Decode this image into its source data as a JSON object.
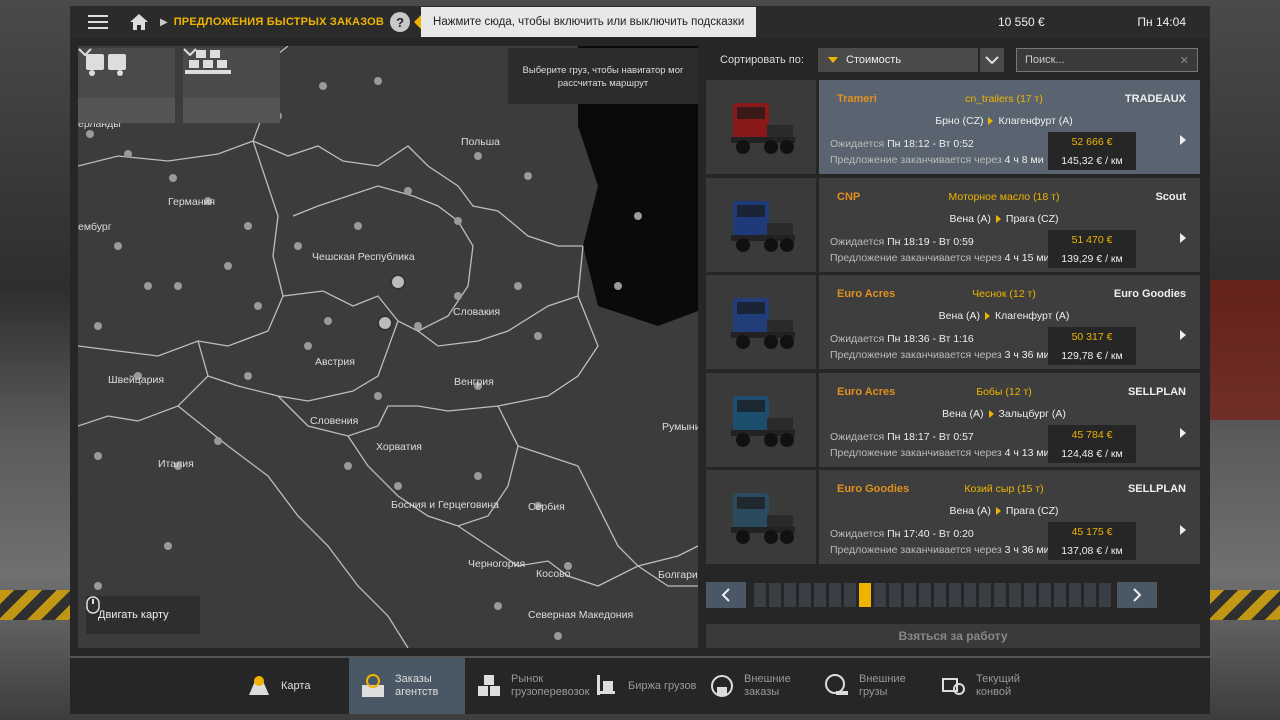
{
  "topbar": {
    "breadcrumb": "ПРЕДЛОЖЕНИЯ БЫСТРЫХ ЗАКАЗОВ",
    "help": "?",
    "tooltip": "Нажмите сюда, чтобы включить или выключить подсказки",
    "money": "10 550 €",
    "clock": "Пн 14:04"
  },
  "map": {
    "hint": "Выберите груз, чтобы навигатор мог рассчитать маршрут",
    "move_map": "Двигать карту",
    "labels": [
      {
        "text": "ерланды",
        "k": "l1"
      },
      {
        "text": "Польша",
        "k": "l2"
      },
      {
        "text": "Германия",
        "k": "l3"
      },
      {
        "text": "ембург",
        "k": "l4"
      },
      {
        "text": "Чешская Республика",
        "k": "l5"
      },
      {
        "text": "Словакия",
        "k": "l6"
      },
      {
        "text": "Австрия",
        "k": "l7"
      },
      {
        "text": "Швейцария",
        "k": "l8"
      },
      {
        "text": "Венгрия",
        "k": "l9"
      },
      {
        "text": "Словения",
        "k": "l10"
      },
      {
        "text": "Хорватия",
        "k": "l11"
      },
      {
        "text": "Румыни",
        "k": "l12"
      },
      {
        "text": "Италия",
        "k": "l13"
      },
      {
        "text": "Босния и Герцеговина",
        "k": "l14"
      },
      {
        "text": "Сербия",
        "k": "l15"
      },
      {
        "text": "Черногория",
        "k": "l16"
      },
      {
        "text": "Косово",
        "k": "l17"
      },
      {
        "text": "Болгари",
        "k": "l18"
      },
      {
        "text": "Северная Македония",
        "k": "l19"
      }
    ]
  },
  "sort": {
    "label": "Сортировать по:",
    "value": "Стоимость",
    "search_placeholder": "Поиск..."
  },
  "jobs": [
    {
      "logo_left": "Trameri",
      "cargo": "cn_trailers (17 т)",
      "logo_right": "TRADEAUX",
      "from": "Брно (CZ)",
      "to": "Клагенфурт (A)",
      "when_label": "Ожидается",
      "when": "Пн 18:12 - Вт 0:52",
      "expire_label": "Предложение заканчивается через",
      "expire": "4 ч 8 ми",
      "pay": "52 666 €",
      "perkm": "145,32 € / км",
      "truck_color": "#8a1a1a"
    },
    {
      "logo_left": "CNP",
      "cargo": "Моторное масло (18 т)",
      "logo_right": "Scout",
      "from": "Вена (A)",
      "to": "Прага (CZ)",
      "when_label": "Ожидается",
      "when": "Пн 18:19 - Вт 0:59",
      "expire_label": "Предложение заканчивается через",
      "expire": "4 ч 15 ми",
      "pay": "51 470 €",
      "perkm": "139,29 € / км",
      "truck_color": "#1e3a7a"
    },
    {
      "logo_left": "Euro Acres",
      "cargo": "Чеснок (12 т)",
      "logo_right": "Euro Goodies",
      "from": "Вена (A)",
      "to": "Клагенфурт (A)",
      "when_label": "Ожидается",
      "when": "Пн 18:36 - Вт 1:16",
      "expire_label": "Предложение заканчивается через",
      "expire": "3 ч 36 ми",
      "pay": "50 317 €",
      "perkm": "129,78 € / км",
      "truck_color": "#213e7a"
    },
    {
      "logo_left": "Euro Acres",
      "cargo": "Бобы (12 т)",
      "logo_right": "SELLPLAN",
      "from": "Вена (A)",
      "to": "Зальцбург (A)",
      "when_label": "Ожидается",
      "when": "Пн 18:17 - Вт 0:57",
      "expire_label": "Предложение заканчивается через",
      "expire": "4 ч 13 ми",
      "pay": "45 784 €",
      "perkm": "124,48 € / км",
      "truck_color": "#1d4e6e"
    },
    {
      "logo_left": "Euro Goodies",
      "cargo": "Козий сыр (15 т)",
      "logo_right": "SELLPLAN",
      "from": "Вена (A)",
      "to": "Прага (CZ)",
      "when_label": "Ожидается",
      "when": "Пн 17:40 - Вт 0:20",
      "expire_label": "Предложение заканчивается через",
      "expire": "3 ч 36 ми",
      "pay": "45 175 €",
      "perkm": "137,08 € / км",
      "truck_color": "#2a4a5e"
    }
  ],
  "pager": {
    "active": 7
  },
  "take_job": "Взяться за работу",
  "nav": [
    {
      "label": "Карта",
      "icon": "map-icon"
    },
    {
      "label": "Заказы агентств",
      "icon": "clock-box-icon"
    },
    {
      "label": "Рынок грузоперевозок",
      "icon": "boxes-icon"
    },
    {
      "label": "Биржа грузов",
      "icon": "forklift-icon"
    },
    {
      "label": "Внешние заказы",
      "icon": "globe-box-icon"
    },
    {
      "label": "Внешние грузы",
      "icon": "globe-pallet-icon"
    },
    {
      "label": "Текущий конвой",
      "icon": "convoy-icon"
    }
  ]
}
